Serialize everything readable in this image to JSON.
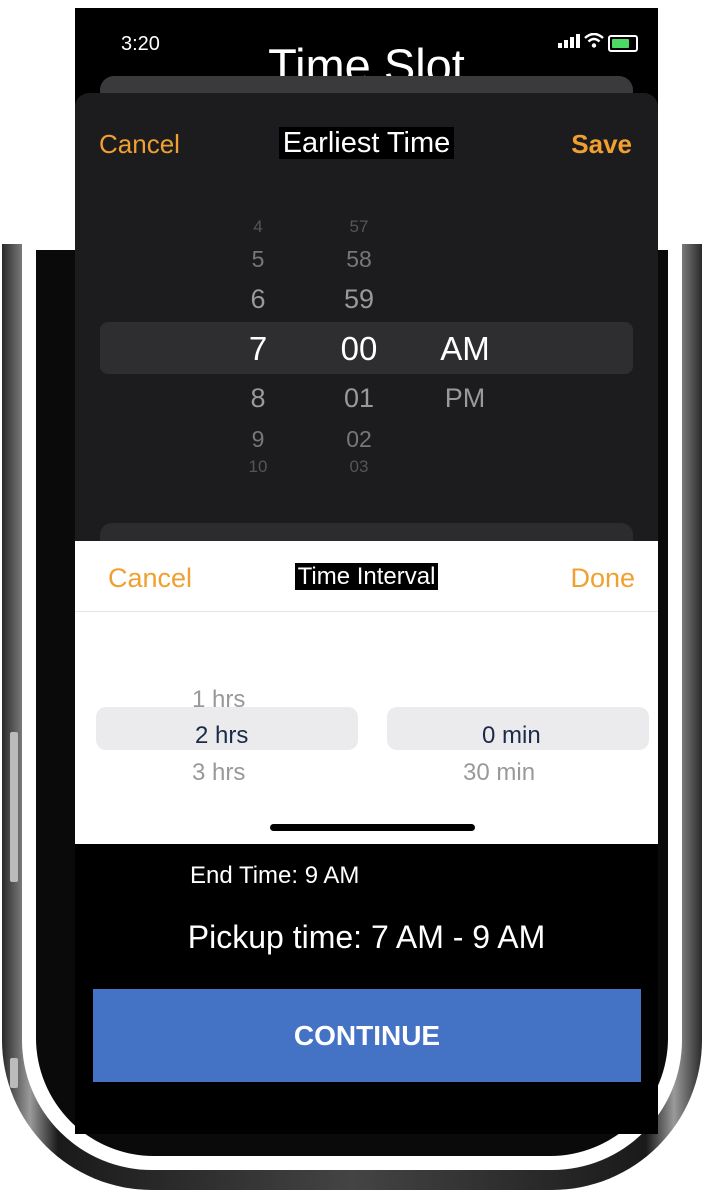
{
  "status_bar": {
    "time": "3:20",
    "icons": [
      "signal-icon",
      "wifi-icon",
      "battery-charging-icon"
    ]
  },
  "app_title": "Time Slot",
  "earliest_sheet": {
    "cancel_label": "Cancel",
    "title": "Earliest Time",
    "save_label": "Save",
    "hours": [
      "4",
      "5",
      "6",
      "7",
      "8",
      "9",
      "10"
    ],
    "minutes": [
      "57",
      "58",
      "59",
      "00",
      "01",
      "02",
      "03"
    ],
    "periods": [
      "AM",
      "PM"
    ],
    "selected": {
      "hour": "7",
      "minute": "00",
      "period": "AM"
    }
  },
  "interval_sheet": {
    "cancel_label": "Cancel",
    "title": "Time Interval",
    "done_label": "Done",
    "hours": [
      "1 hrs",
      "2 hrs",
      "3 hrs"
    ],
    "minutes": [
      "0 min",
      "30 min"
    ],
    "selected": {
      "hours": "2 hrs",
      "minutes": "0 min"
    }
  },
  "summary": {
    "end_time": "End Time: 9 AM",
    "pickup_time": "Pickup time: 7 AM - 9 AM"
  },
  "continue_label": "CONTINUE",
  "colors": {
    "accent": "#f0a030",
    "button": "#4472c4",
    "sheet_dark": "#1c1c1e"
  }
}
